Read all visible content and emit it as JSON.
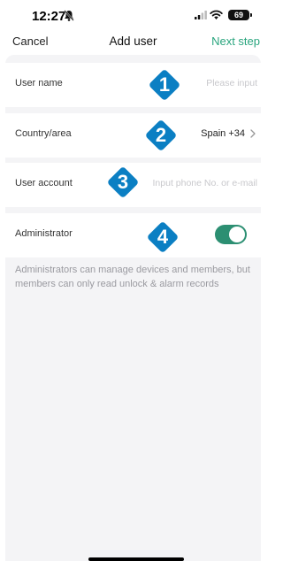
{
  "status_bar": {
    "time": "12:27",
    "battery": "69"
  },
  "nav": {
    "cancel_label": "Cancel",
    "title": "Add user",
    "next_label": "Next step"
  },
  "form": {
    "user_name": {
      "label": "User name",
      "placeholder": "Please input"
    },
    "country": {
      "label": "Country/area",
      "value": "Spain +34"
    },
    "user_account": {
      "label": "User account",
      "placeholder": "Input phone No. or e-mail"
    },
    "administrator": {
      "label": "Administrator",
      "enabled": true
    }
  },
  "hint": "Administrators can manage devices and members, but members can only read unlock & alarm records",
  "annotations": [
    "1",
    "2",
    "3",
    "4"
  ],
  "colors": {
    "accent": "#2aa57e",
    "toggle": "#2c8f72",
    "badge": "#0b7fc3"
  }
}
